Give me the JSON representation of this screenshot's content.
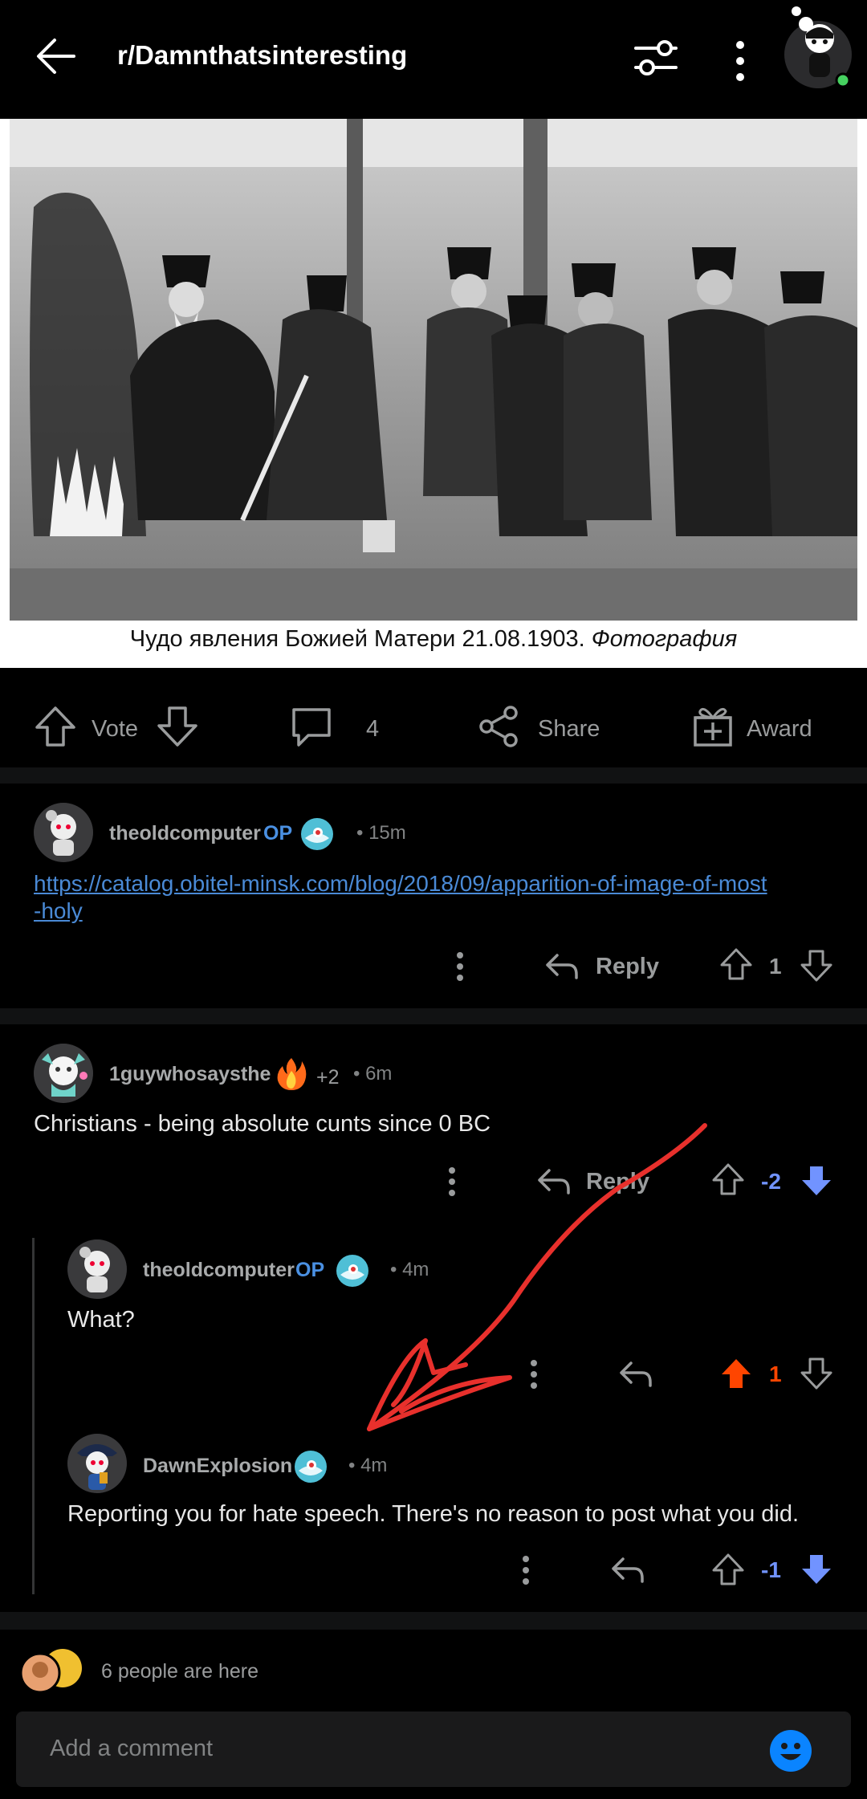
{
  "header": {
    "title": "r/Damnthatsinteresting"
  },
  "post": {
    "caption_regular": "Чудо явления Божией Матери 21.08.1903. ",
    "caption_italic": "Фотография"
  },
  "action_bar": {
    "vote_label": "Vote",
    "comment_count": "4",
    "share_label": "Share",
    "award_label": "Award"
  },
  "comments": [
    {
      "username": "theoldcomputer",
      "op": "OP",
      "time": "• 15m",
      "link_line1": "https://catalog.obitel-minsk.com/blog/2018/09/apparition-of-image-of-most",
      "link_line2": "-holy",
      "reply_label": "Reply",
      "score": "1"
    },
    {
      "username": "1guywhosaysthe",
      "award_count": "+2",
      "time": "• 6m",
      "text": "Christians - being absolute cunts since 0 BC",
      "reply_label": "Reply",
      "score": "-2"
    },
    {
      "username": "theoldcomputer",
      "op": "OP",
      "time": "• 4m",
      "text": "What?",
      "score": "1"
    },
    {
      "username": "DawnExplosion",
      "time": "• 4m",
      "text": "Reporting you for hate speech. There's no reason to post what you did.",
      "score": "-1"
    }
  ],
  "presence": {
    "text": "6 people are here"
  },
  "comment_input": {
    "placeholder": "Add a comment"
  },
  "colors": {
    "upvote": "#ff4500",
    "downvote": "#7193ff",
    "op": "#4a90e2",
    "link": "#4a8ad6",
    "annotation": "#e8302c"
  }
}
